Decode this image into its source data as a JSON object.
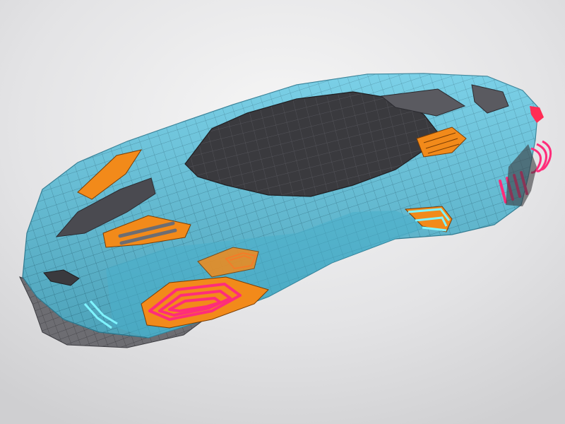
{
  "scene": {
    "subject": "hover-car-wireframe-model",
    "colors": {
      "background_light": "#f4f4f4",
      "background_dark": "#cfcfd1",
      "body": "#5ec6e2",
      "body_shadow": "#49aecb",
      "mesh_line": "#2e7e96",
      "canopy": "#3a3a3e",
      "canopy_mesh": "#55555b",
      "intake_orange": "#f28a1a",
      "accent_pink": "#ff2d7a",
      "accent_cyan": "#7ff4ff",
      "underbody_grey": "#6d6d72",
      "vent_grey": "#5a5a60"
    }
  }
}
